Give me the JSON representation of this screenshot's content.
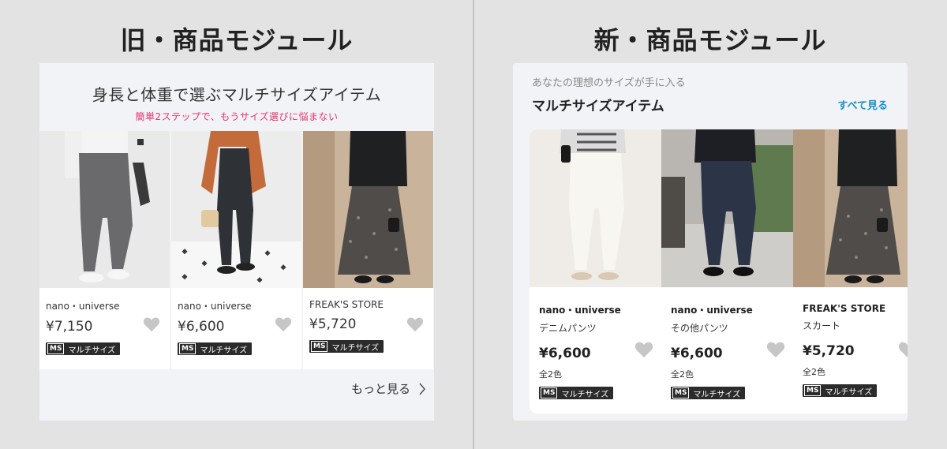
{
  "left": {
    "heading": "旧・商品モジュール",
    "title": "身長と体重で選ぶマルチサイズアイテム",
    "subtitle": "簡単2ステップで、もうサイズ選びに悩まない",
    "more_label": "もっと見る",
    "products": [
      {
        "brand": "nano・universe",
        "price": "¥7,150",
        "badge_ms": "MS",
        "badge_label": "マルチサイズ"
      },
      {
        "brand": "nano・universe",
        "price": "¥6,600",
        "badge_ms": "MS",
        "badge_label": "マルチサイズ"
      },
      {
        "brand": "FREAK'S STORE",
        "price": "¥5,720",
        "badge_ms": "MS",
        "badge_label": "マルチサイズ"
      }
    ]
  },
  "right": {
    "heading": "新・商品モジュール",
    "eyebrow": "あなたの理想のサイズが手に入る",
    "title": "マルチサイズアイテム",
    "see_all_label": "すべて見る",
    "products": [
      {
        "brand": "nano・universe",
        "category": "デニムパンツ",
        "price": "¥6,600",
        "colors": "全2色",
        "badge_ms": "MS",
        "badge_label": "マルチサイズ"
      },
      {
        "brand": "nano・universe",
        "category": "その他パンツ",
        "price": "¥6,600",
        "colors": "全2色",
        "badge_ms": "MS",
        "badge_label": "マルチサイズ"
      },
      {
        "brand": "FREAK'S STORE",
        "category": "スカート",
        "price": "¥5,720",
        "colors": "全2色",
        "badge_ms": "MS",
        "badge_label": "マルチサイズ"
      }
    ]
  },
  "icons": {
    "favorite": "heart-icon",
    "more": "chevron-right-icon"
  },
  "colors": {
    "subtitle_pink": "#e8336a",
    "link_blue": "#1a8fc8",
    "panel_bg": "#f2f3f7"
  }
}
